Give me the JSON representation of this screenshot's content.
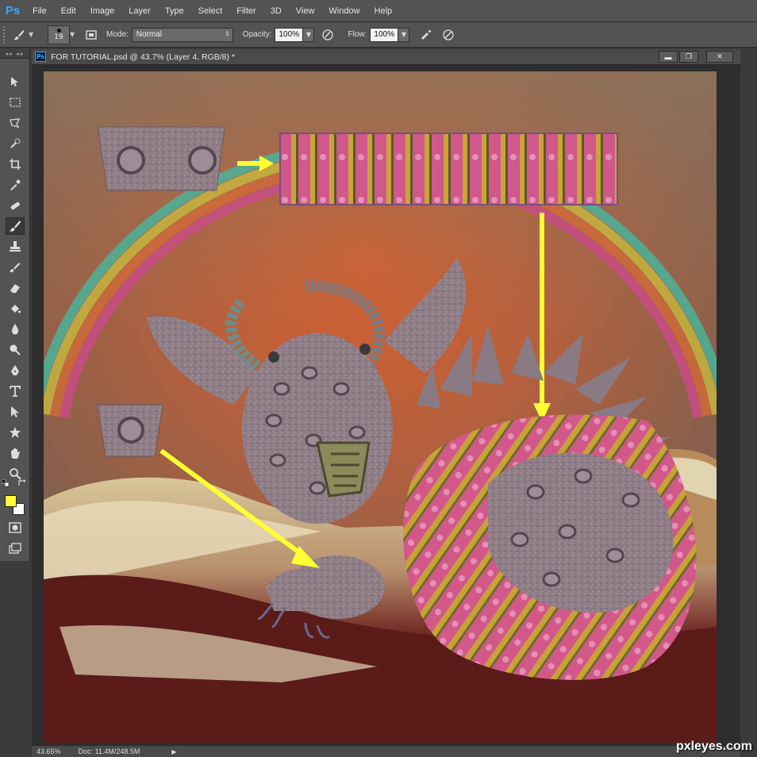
{
  "app": {
    "logo": "Ps"
  },
  "menu": [
    "File",
    "Edit",
    "Image",
    "Layer",
    "Type",
    "Select",
    "Filter",
    "3D",
    "View",
    "Window",
    "Help"
  ],
  "options": {
    "brush_size": "19",
    "mode_label": "Mode:",
    "mode_value": "Normal",
    "opacity_label": "Opacity:",
    "opacity_value": "100%",
    "flow_label": "Flow:",
    "flow_value": "100%"
  },
  "toolpanel": {
    "header": "▸▸ ◂◂"
  },
  "document": {
    "title": "FOR TUTORIAL.psd @ 43.7% (Layer 4, RGB/8) *",
    "window_buttons": [
      "▬",
      "❐",
      "✕"
    ]
  },
  "status": {
    "zoom": "43.65%",
    "doc_info": "Doc: 11.4M/248.5M",
    "arrow": "▶"
  },
  "colors": {
    "foreground": "#ffff33",
    "background": "#ffffff",
    "accent": "#31a8ff"
  },
  "watermark": "pxleyes.com"
}
